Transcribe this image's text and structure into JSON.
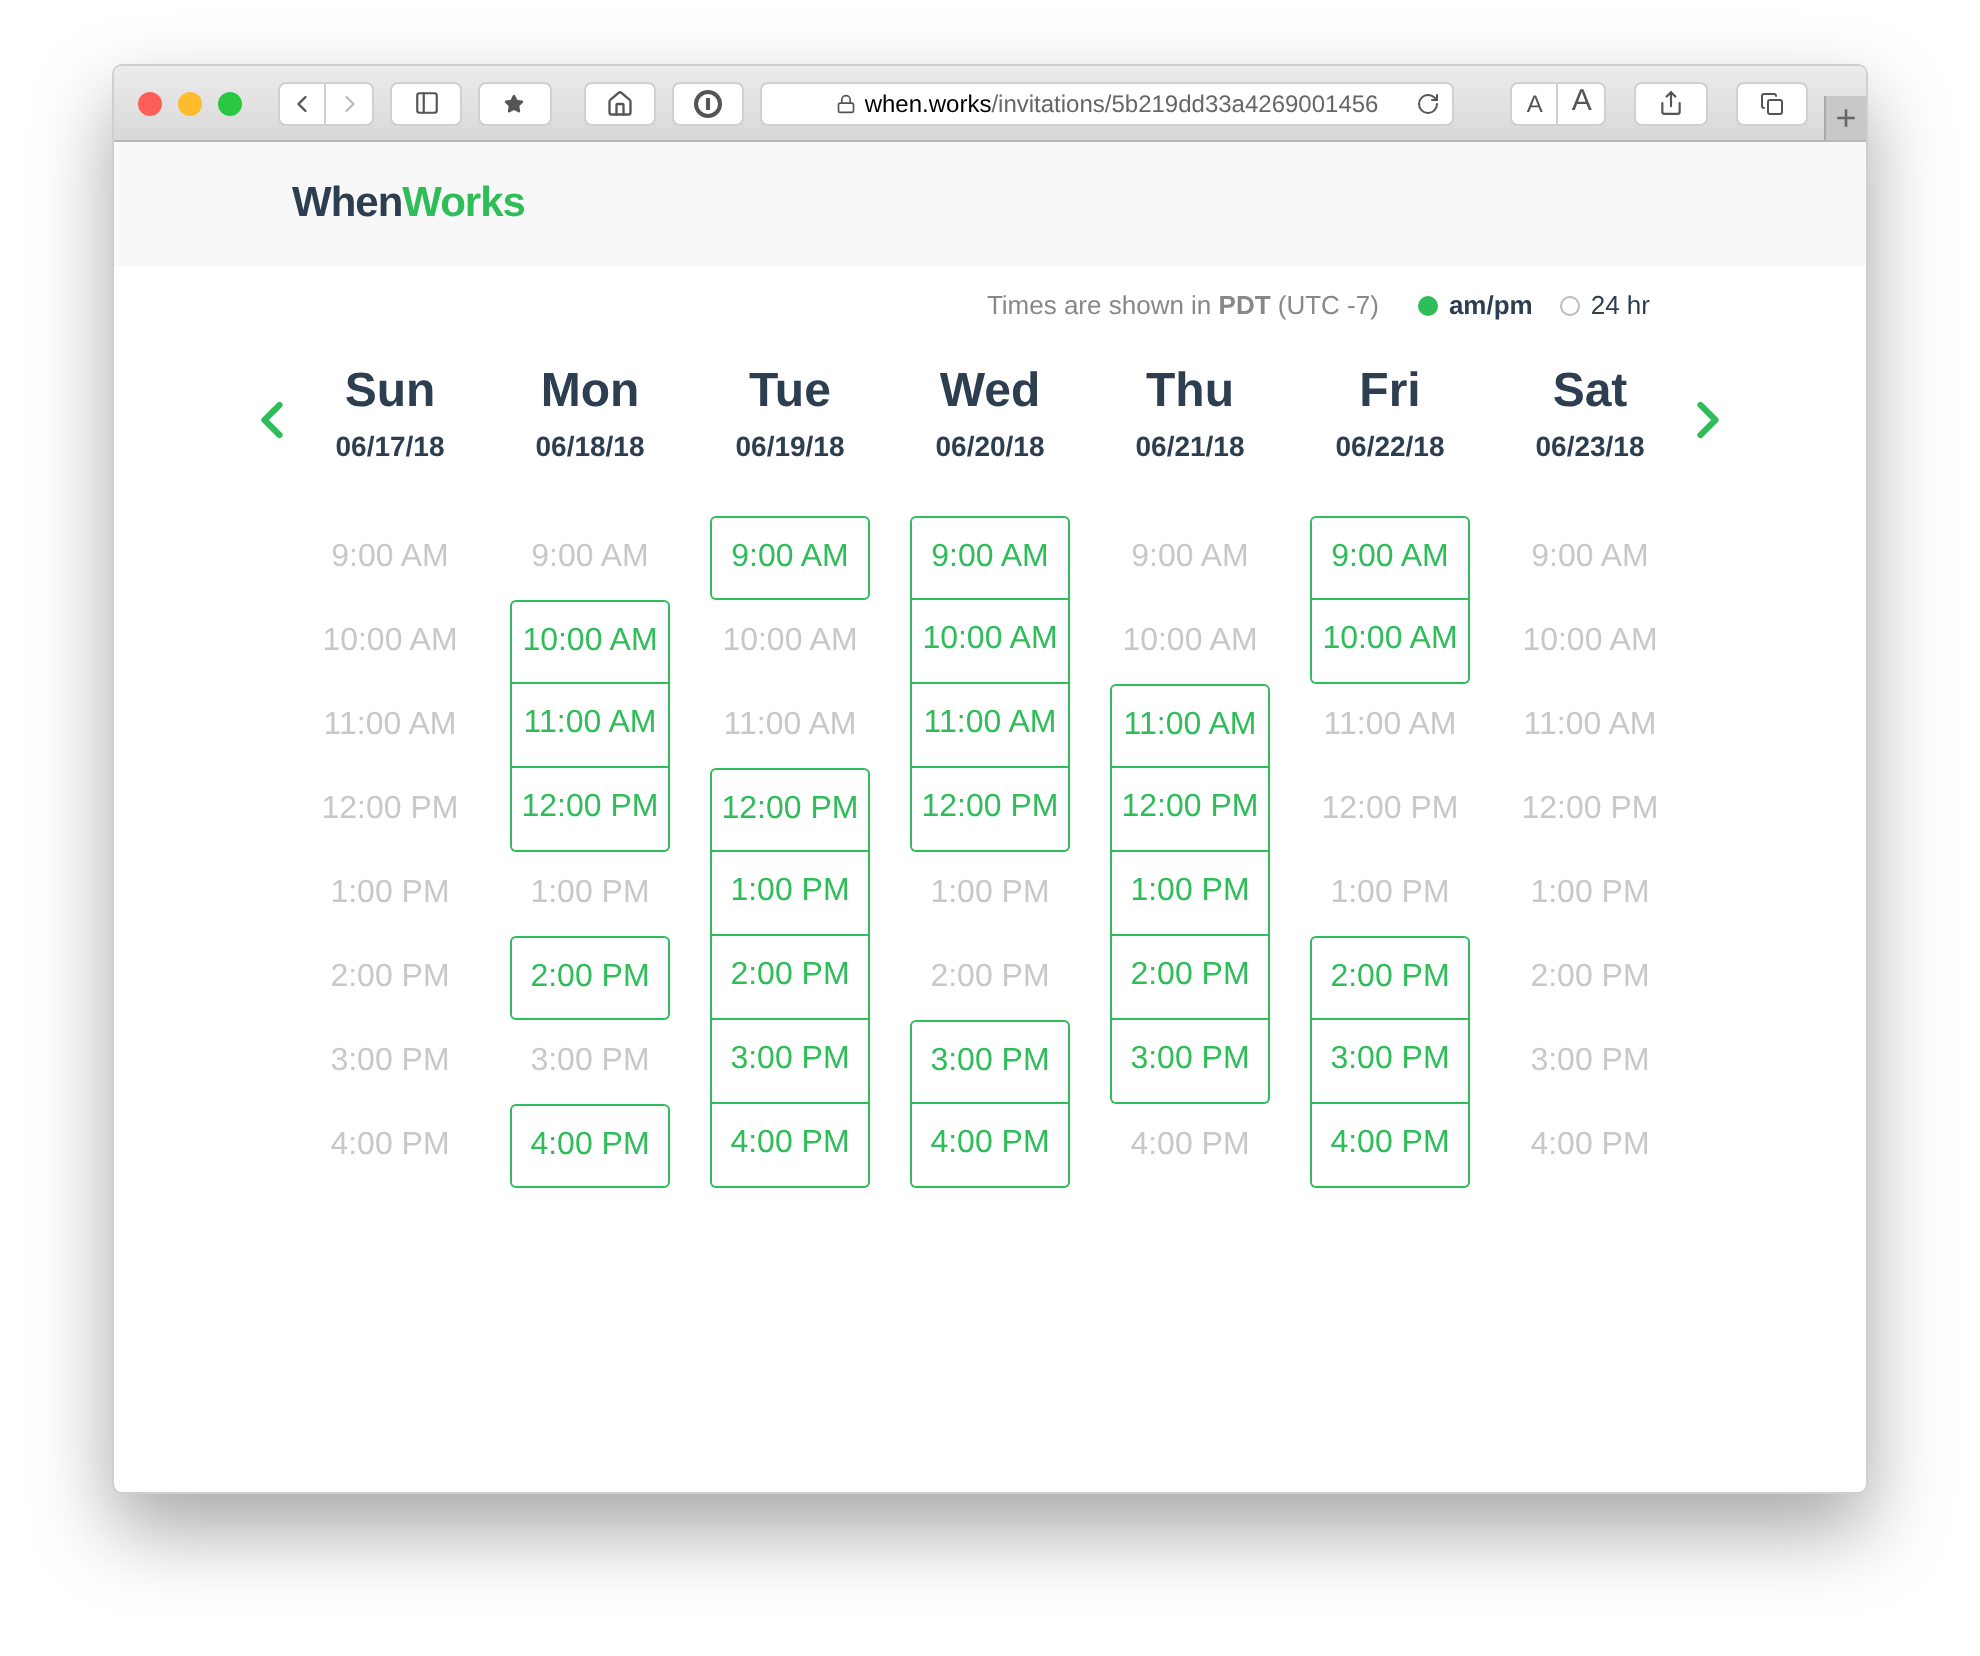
{
  "toolbar": {
    "url_domain": "when.works",
    "url_path": "/invitations/5b219dd33a4269001456",
    "font_buttons": [
      "A",
      "A"
    ],
    "new_tab": "+"
  },
  "logo": {
    "first": "When",
    "second": "Works"
  },
  "timezone": {
    "text": "Times are shown in **PDT** (UTC -7)"
  },
  "formats": [
    {
      "label": "am/pm",
      "selected": true
    },
    {
      "label": "24 hr",
      "selected": false
    }
  ],
  "days": [
    {
      "name": "Sun",
      "date": "06/17/18",
      "slots": [
        {
          "time": "9:00 AM",
          "available": false
        },
        {
          "time": "10:00 AM",
          "available": false
        },
        {
          "time": "11:00 AM",
          "available": false
        },
        {
          "time": "12:00 PM",
          "available": false
        },
        {
          "time": "1:00 PM",
          "available": false
        },
        {
          "time": "2:00 PM",
          "available": false
        },
        {
          "time": "3:00 PM",
          "available": false
        },
        {
          "time": "4:00 PM",
          "available": false
        }
      ]
    },
    {
      "name": "Mon",
      "date": "06/18/18",
      "slots": [
        {
          "time": "9:00 AM",
          "available": false
        },
        {
          "time": "10:00 AM",
          "available": true
        },
        {
          "time": "11:00 AM",
          "available": true
        },
        {
          "time": "12:00 PM",
          "available": true
        },
        {
          "time": "1:00 PM",
          "available": false
        },
        {
          "time": "2:00 PM",
          "available": true
        },
        {
          "time": "3:00 PM",
          "available": false
        },
        {
          "time": "4:00 PM",
          "available": true
        }
      ]
    },
    {
      "name": "Tue",
      "date": "06/19/18",
      "slots": [
        {
          "time": "9:00 AM",
          "available": true
        },
        {
          "time": "10:00 AM",
          "available": false
        },
        {
          "time": "11:00 AM",
          "available": false
        },
        {
          "time": "12:00 PM",
          "available": true
        },
        {
          "time": "1:00 PM",
          "available": true
        },
        {
          "time": "2:00 PM",
          "available": true
        },
        {
          "time": "3:00 PM",
          "available": true
        },
        {
          "time": "4:00 PM",
          "available": true
        }
      ]
    },
    {
      "name": "Wed",
      "date": "06/20/18",
      "slots": [
        {
          "time": "9:00 AM",
          "available": true
        },
        {
          "time": "10:00 AM",
          "available": true
        },
        {
          "time": "11:00 AM",
          "available": true
        },
        {
          "time": "12:00 PM",
          "available": true
        },
        {
          "time": "1:00 PM",
          "available": false
        },
        {
          "time": "2:00 PM",
          "available": false
        },
        {
          "time": "3:00 PM",
          "available": true
        },
        {
          "time": "4:00 PM",
          "available": true
        }
      ]
    },
    {
      "name": "Thu",
      "date": "06/21/18",
      "slots": [
        {
          "time": "9:00 AM",
          "available": false
        },
        {
          "time": "10:00 AM",
          "available": false
        },
        {
          "time": "11:00 AM",
          "available": true
        },
        {
          "time": "12:00 PM",
          "available": true
        },
        {
          "time": "1:00 PM",
          "available": true
        },
        {
          "time": "2:00 PM",
          "available": true
        },
        {
          "time": "3:00 PM",
          "available": true
        },
        {
          "time": "4:00 PM",
          "available": false
        }
      ]
    },
    {
      "name": "Fri",
      "date": "06/22/18",
      "slots": [
        {
          "time": "9:00 AM",
          "available": true
        },
        {
          "time": "10:00 AM",
          "available": true
        },
        {
          "time": "11:00 AM",
          "available": false
        },
        {
          "time": "12:00 PM",
          "available": false
        },
        {
          "time": "1:00 PM",
          "available": false
        },
        {
          "time": "2:00 PM",
          "available": true
        },
        {
          "time": "3:00 PM",
          "available": true
        },
        {
          "time": "4:00 PM",
          "available": true
        }
      ]
    },
    {
      "name": "Sat",
      "date": "06/23/18",
      "slots": [
        {
          "time": "9:00 AM",
          "available": false
        },
        {
          "time": "10:00 AM",
          "available": false
        },
        {
          "time": "11:00 AM",
          "available": false
        },
        {
          "time": "12:00 PM",
          "available": false
        },
        {
          "time": "1:00 PM",
          "available": false
        },
        {
          "time": "2:00 PM",
          "available": false
        },
        {
          "time": "3:00 PM",
          "available": false
        },
        {
          "time": "4:00 PM",
          "available": false
        }
      ]
    }
  ]
}
